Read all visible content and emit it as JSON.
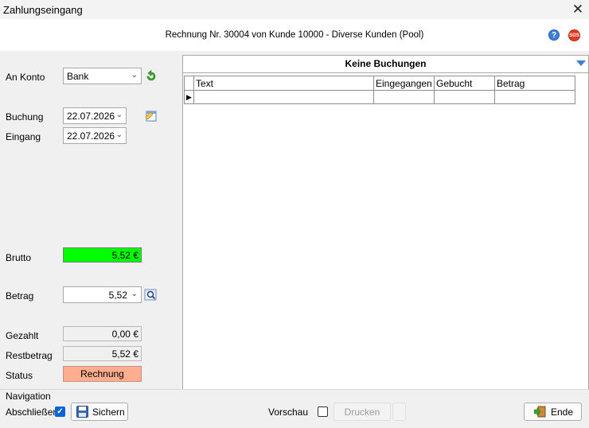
{
  "window": {
    "title": "Zahlungseingang",
    "close_glyph": "✕"
  },
  "header": {
    "text": "Rechnung Nr. 30004 von Kunde 10000 - Diverse Kunden (Pool)",
    "help_glyph": "?",
    "sos_text": "SOS"
  },
  "form": {
    "account_label": "An Konto",
    "account_value": "Bank",
    "booking_label": "Buchung",
    "booking_date": "22.07.2026",
    "receipt_label": "Eingang",
    "receipt_date": "22.07.2026",
    "gross_label": "Brutto",
    "gross_value": "5,52 €",
    "amount_label": "Betrag",
    "amount_value": "5,52",
    "paid_label": "Gezahlt",
    "paid_value": "0,00 €",
    "remaining_label": "Restbetrag",
    "remaining_value": "5,52 €",
    "status_label": "Status",
    "status_value": "Rechnung"
  },
  "grid": {
    "title": "Keine Buchungen",
    "columns": [
      "Text",
      "Eingegangen",
      "Gebucht",
      "Betrag"
    ],
    "row_indicator": "▶"
  },
  "footer": {
    "navigation_label": "Navigation",
    "close_label": "Abschließen",
    "close_checked": true,
    "save_label": "Sichern",
    "preview_label": "Vorschau",
    "preview_checked": false,
    "print_label": "Drucken",
    "end_label": "Ende"
  },
  "icons": {
    "close": "close-icon",
    "help": "help-icon",
    "sos": "sos-icon",
    "refresh": "refresh-arrow-icon",
    "calendar_note": "calendar-note-icon",
    "magnifier": "magnifier-icon",
    "save": "floppy-disk-icon",
    "exit": "exit-door-icon",
    "dropdown": "chevron-down-icon"
  },
  "colors": {
    "gross_bg": "#00ff00",
    "status_bg": "#ffad8f",
    "accent": "#0a64d8"
  }
}
